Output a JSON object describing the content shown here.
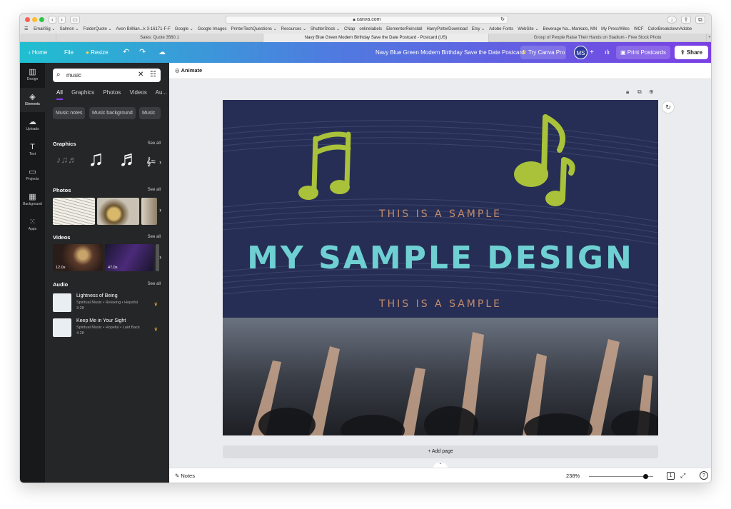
{
  "browser": {
    "url": "canva.com",
    "bookmarks": [
      "EmailSig ⌄",
      "Salmon ⌄",
      "FolderQuote ⌄",
      "Avon Brillian...k 3-16171-F-F",
      "Google ⌄",
      "Google Images",
      "PrinterTechQuestions ⌄",
      "Resources ⌄",
      "ShutterStock ⌄",
      "CNap",
      "onlinelabels",
      "ElementorReinstall",
      "HarryPotterDownload",
      "Etsy ⌄",
      "Adobe Fonts",
      "WebSite ⌄",
      "Beverage Na...Mankato, MN",
      "My PressWiles",
      "WCF",
      "ColorBreakdownAdobe"
    ],
    "tabs": [
      "Sales: Quote 3560.1",
      "Navy Blue Green Modern Birthday Save the Date Postcard - Postcard (US)",
      "Group of People Raise Their Hands on Stadium - Free Stock Photo"
    ]
  },
  "header": {
    "home": "Home",
    "file": "File",
    "resize": "Resize",
    "title": "Navy Blue Green Modern Birthday Save the Date Postcard",
    "try_pro": "Try Canva Pro",
    "avatar": "MS",
    "print": "Print Postcards",
    "share": "Share"
  },
  "rail": [
    {
      "label": "Design",
      "icon": "design-icon"
    },
    {
      "label": "Elements",
      "icon": "elements-icon"
    },
    {
      "label": "Uploads",
      "icon": "uploads-icon"
    },
    {
      "label": "Text",
      "icon": "text-icon"
    },
    {
      "label": "Projects",
      "icon": "folder-icon"
    },
    {
      "label": "Background",
      "icon": "background-icon"
    },
    {
      "label": "Apps",
      "icon": "apps-icon"
    }
  ],
  "panel": {
    "search_value": "music",
    "tabs": [
      "All",
      "Graphics",
      "Photos",
      "Videos",
      "Au..."
    ],
    "chips": [
      "Music notes",
      "Music background",
      "Music"
    ],
    "graphics_title": "Graphics",
    "photos_title": "Photos",
    "videos_title": "Videos",
    "audio_title": "Audio",
    "see_all": "See all",
    "videos": [
      {
        "duration": "12.0s"
      },
      {
        "duration": "47.0s"
      }
    ],
    "audio": [
      {
        "title": "Lightness of Being",
        "meta": "Spiritual Music • Relaxing • Hopeful",
        "duration": "3:28"
      },
      {
        "title": "Keep Me in Your Sight",
        "meta": "Spiritual Music • Hopeful • Laid Back",
        "duration": "4:28"
      }
    ]
  },
  "workspace": {
    "animate": "Animate",
    "design": {
      "sample_top": "THIS IS A SAMPLE",
      "headline": "MY SAMPLE DESIGN",
      "sample_bottom": "THIS IS A SAMPLE"
    },
    "add_page": "+ Add page",
    "notes": "Notes",
    "zoom": "238%",
    "zoom_level": 0.88,
    "page_count": "1"
  },
  "colors": {
    "navy": "#262e55",
    "accent_green": "#a9c23a",
    "headline": "#6fd0d3",
    "sample_text": "#c48b6b",
    "panel": "#252627"
  }
}
